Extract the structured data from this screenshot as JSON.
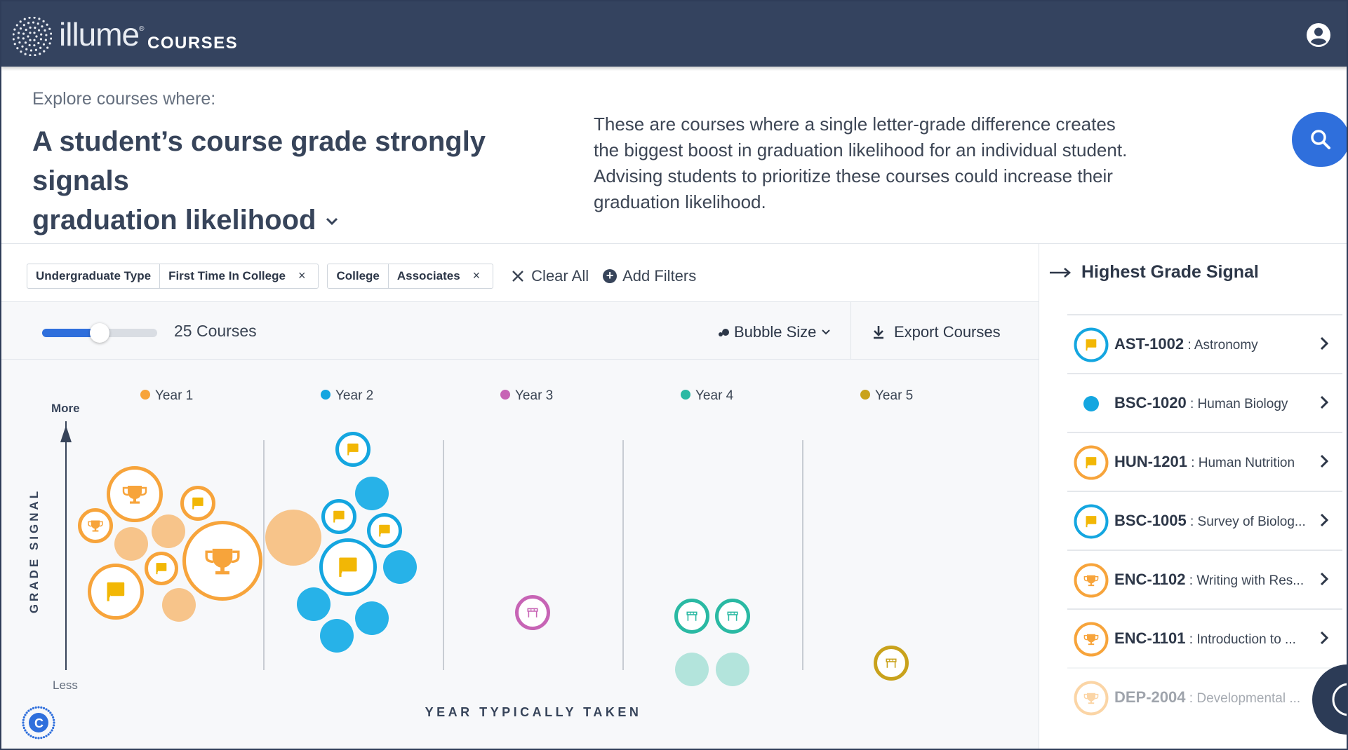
{
  "header": {
    "logo_text": "illume",
    "logo_reg": "®",
    "product": "COURSES",
    "user_icon": "user-circle-icon"
  },
  "explore": {
    "label": "Explore courses where:",
    "headline_line1": "A student’s course grade strongly signals",
    "headline_line2": "graduation likelihood",
    "description": "These are courses where a single letter-grade difference creates the biggest boost in graduation likelihood for an individual student. Advising students to prioritize these courses could increase their graduation likelihood.",
    "search_icon": "search-icon"
  },
  "filters": {
    "chips": [
      {
        "key": "Undergraduate Type",
        "value": "First Time In College",
        "close": "×"
      },
      {
        "key": "College",
        "value": "Associates",
        "close": "×"
      }
    ],
    "clear_all": "Clear All",
    "add_filters": "Add Filters"
  },
  "toolbar": {
    "slider_value": 0.5,
    "course_count": "25 Courses",
    "bubble_size": "Bubble Size",
    "export": "Export Courses"
  },
  "colors": {
    "year1": "#f7a43b",
    "year2": "#14a6e0",
    "year3": "#c764b5",
    "year4": "#2ab9a3",
    "year5": "#c9a21c",
    "flag": "#f2b705",
    "accent": "#2f6fdc",
    "header": "#34435f"
  },
  "chart_data": {
    "type": "bubble",
    "y_axis_label": "GRADE SIGNAL",
    "y_top_label": "More",
    "y_bottom_label": "Less",
    "x_axis_label": "YEAR TYPICALLY TAKEN",
    "legend": [
      {
        "name": "Year 1",
        "color_key": "year1"
      },
      {
        "name": "Year 2",
        "color_key": "year2"
      },
      {
        "name": "Year 3",
        "color_key": "year3"
      },
      {
        "name": "Year 4",
        "color_key": "year4"
      },
      {
        "name": "Year 5",
        "color_key": "year5"
      }
    ]
  },
  "highest_grade_signal": {
    "title": "Highest Grade Signal",
    "items": [
      {
        "code": "AST-1002",
        "name": " : Astronomy",
        "icon": "flag",
        "color_key": "year2",
        "faded": false
      },
      {
        "code": "BSC-1020",
        "name": " : Human Biology",
        "icon": "dot",
        "color_key": "year2",
        "faded": false
      },
      {
        "code": "HUN-1201",
        "name": " : Human Nutrition",
        "icon": "flag",
        "color_key": "year1",
        "faded": false
      },
      {
        "code": "BSC-1005",
        "name": " : Survey of Biolog...",
        "icon": "flag",
        "color_key": "year2",
        "faded": false
      },
      {
        "code": "ENC-1102",
        "name": " : Writing with Res...",
        "icon": "trophy",
        "color_key": "year1",
        "faded": false
      },
      {
        "code": "ENC-1101",
        "name": " : Introduction to ...",
        "icon": "trophy",
        "color_key": "year1",
        "faded": false
      },
      {
        "code": "DEP-2004",
        "name": " : Developmental ...",
        "icon": "trophy",
        "color_key": "year1",
        "faded": true
      }
    ]
  }
}
